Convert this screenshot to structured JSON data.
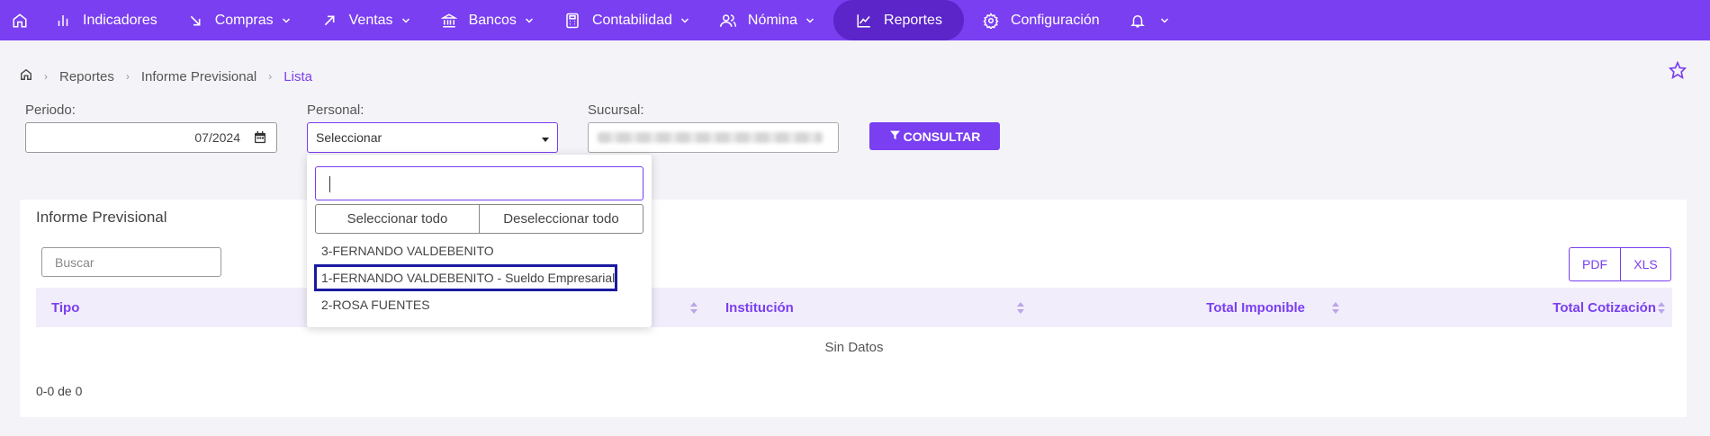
{
  "nav": {
    "items": [
      {
        "label": "Indicadores",
        "icon": "bar-chart-icon",
        "has_chevron": false
      },
      {
        "label": "Compras",
        "icon": "arrow-down-right-icon",
        "has_chevron": true
      },
      {
        "label": "Ventas",
        "icon": "arrow-up-right-icon",
        "has_chevron": true
      },
      {
        "label": "Bancos",
        "icon": "bank-icon",
        "has_chevron": true
      },
      {
        "label": "Contabilidad",
        "icon": "calculator-icon",
        "has_chevron": true
      },
      {
        "label": "Nómina",
        "icon": "users-icon",
        "has_chevron": true
      },
      {
        "label": "Reportes",
        "icon": "line-chart-icon",
        "has_chevron": false,
        "active": true
      },
      {
        "label": "Configuración",
        "icon": "gear-icon",
        "has_chevron": false
      }
    ]
  },
  "breadcrumb": {
    "items": [
      "Reportes",
      "Informe Previsional"
    ],
    "current": "Lista"
  },
  "filters": {
    "periodo_label": "Periodo:",
    "periodo_value": "07/2024",
    "personal_label": "Personal:",
    "personal_value": "Seleccionar",
    "sucursal_label": "Sucursal:",
    "consultar_label": "CONSULTAR"
  },
  "dropdown": {
    "select_all": "Seleccionar todo",
    "deselect_all": "Deseleccionar todo",
    "options": [
      "3-FERNANDO VALDEBENITO",
      "1-FERNANDO VALDEBENITO - Sueldo Empresarial",
      "2-ROSA FUENTES"
    ]
  },
  "card": {
    "title": "Informe Previsional",
    "search_placeholder": "Buscar",
    "export": {
      "pdf": "PDF",
      "xls": "XLS"
    },
    "columns": {
      "tipo": "Tipo",
      "institucion": "Institución",
      "total_imponible": "Total Imponible",
      "total_cotizacion": "Total Cotización"
    },
    "empty_text": "Sin Datos",
    "pager": "0-0 de 0"
  },
  "colors": {
    "accent": "#7a3ff0",
    "accent_dark": "#5b25c9",
    "highlight_border": "#1a1aa0"
  }
}
